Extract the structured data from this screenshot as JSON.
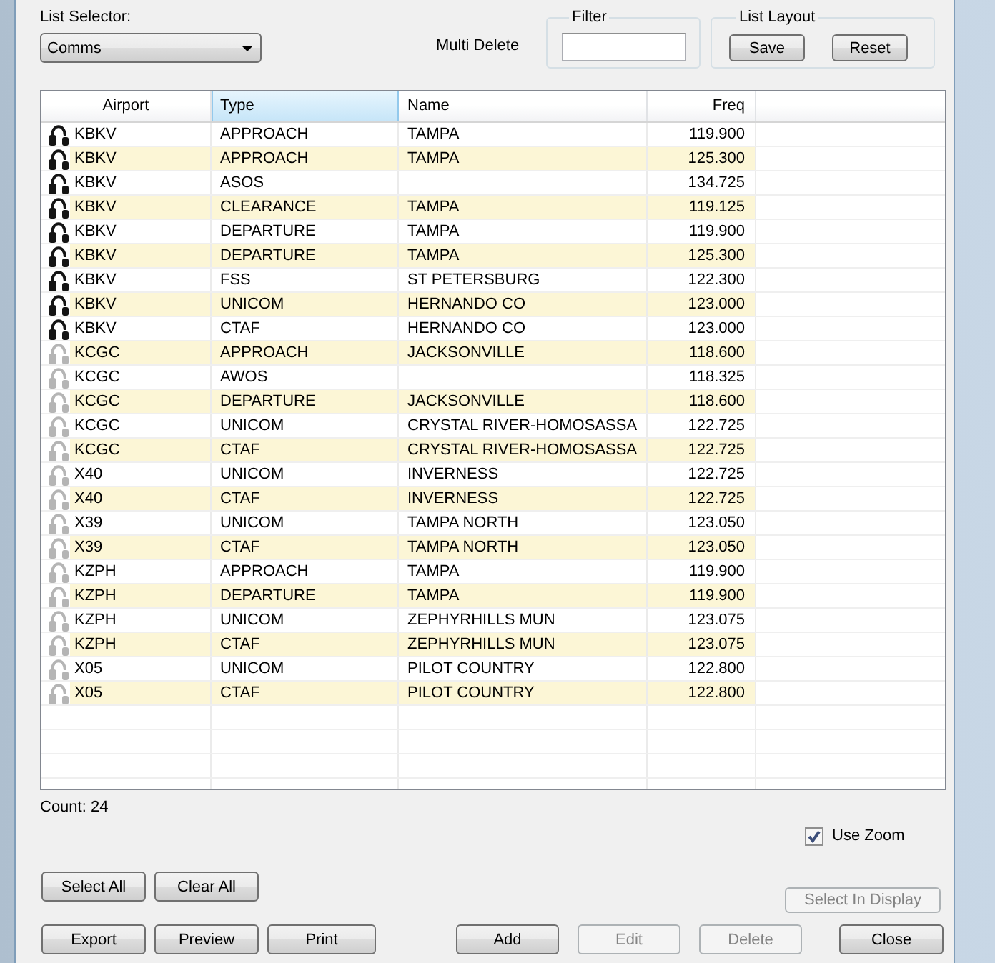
{
  "list_selector": {
    "label": "List Selector:",
    "value": "Comms"
  },
  "multi_delete": {
    "label": "Multi Delete"
  },
  "filter": {
    "title": "Filter"
  },
  "list_layout": {
    "title": "List Layout",
    "buttons": [
      {
        "label": "Save"
      },
      {
        "label": "Reset"
      }
    ]
  },
  "table": {
    "columns": [
      {
        "label": "Airport",
        "selected": false
      },
      {
        "label": "Type",
        "selected": true
      },
      {
        "label": "Name",
        "selected": false
      },
      {
        "label": "Freq",
        "selected": false
      }
    ],
    "rows": [
      {
        "airport": "KBKV",
        "type": "APPROACH",
        "name": "TAMPA",
        "freq": "119.900",
        "dimmed": false
      },
      {
        "airport": "KBKV",
        "type": "APPROACH",
        "name": "TAMPA",
        "freq": "125.300",
        "dimmed": false
      },
      {
        "airport": "KBKV",
        "type": "ASOS",
        "freq": "134.725",
        "dimmed": false
      },
      {
        "airport": "KBKV",
        "type": "CLEARANCE",
        "name": "TAMPA",
        "freq": "119.125",
        "dimmed": false
      },
      {
        "airport": "KBKV",
        "type": "DEPARTURE",
        "name": "TAMPA",
        "freq": "119.900",
        "dimmed": false
      },
      {
        "airport": "KBKV",
        "type": "DEPARTURE",
        "name": "TAMPA",
        "freq": "125.300",
        "dimmed": false
      },
      {
        "airport": "KBKV",
        "type": "FSS",
        "name": "ST PETERSBURG",
        "freq": "122.300",
        "dimmed": false
      },
      {
        "airport": "KBKV",
        "type": "UNICOM",
        "name": "HERNANDO CO",
        "freq": "123.000",
        "dimmed": false
      },
      {
        "airport": "KBKV",
        "type": "CTAF",
        "name": "HERNANDO CO",
        "freq": "123.000",
        "dimmed": false
      },
      {
        "airport": "KCGC",
        "type": "APPROACH",
        "name": "JACKSONVILLE",
        "freq": "118.600",
        "dimmed": true
      },
      {
        "airport": "KCGC",
        "type": "AWOS",
        "freq": "118.325",
        "dimmed": true
      },
      {
        "airport": "KCGC",
        "type": "DEPARTURE",
        "name": "JACKSONVILLE",
        "freq": "118.600",
        "dimmed": true
      },
      {
        "airport": "KCGC",
        "type": "UNICOM",
        "name": "CRYSTAL RIVER-HOMOSASSA",
        "freq": "122.725",
        "dimmed": true
      },
      {
        "airport": "KCGC",
        "type": "CTAF",
        "name": "CRYSTAL RIVER-HOMOSASSA",
        "freq": "122.725",
        "dimmed": true
      },
      {
        "airport": "X40",
        "type": "UNICOM",
        "name": "INVERNESS",
        "freq": "122.725",
        "dimmed": true
      },
      {
        "airport": "X40",
        "type": "CTAF",
        "name": "INVERNESS",
        "freq": "122.725",
        "dimmed": true
      },
      {
        "airport": "X39",
        "type": "UNICOM",
        "name": "TAMPA NORTH",
        "freq": "123.050",
        "dimmed": true
      },
      {
        "airport": "X39",
        "type": "CTAF",
        "name": "TAMPA NORTH",
        "freq": "123.050",
        "dimmed": true
      },
      {
        "airport": "KZPH",
        "type": "APPROACH",
        "name": "TAMPA",
        "freq": "119.900",
        "dimmed": true
      },
      {
        "airport": "KZPH",
        "type": "DEPARTURE",
        "name": "TAMPA",
        "freq": "119.900",
        "dimmed": true
      },
      {
        "airport": "KZPH",
        "type": "UNICOM",
        "name": "ZEPHYRHILLS MUN",
        "freq": "123.075",
        "dimmed": true
      },
      {
        "airport": "KZPH",
        "type": "CTAF",
        "name": "ZEPHYRHILLS MUN",
        "freq": "123.075",
        "dimmed": true
      },
      {
        "airport": "X05",
        "type": "UNICOM",
        "name": "PILOT COUNTRY",
        "freq": "122.800",
        "dimmed": true
      },
      {
        "airport": "X05",
        "type": "CTAF",
        "name": "PILOT COUNTRY",
        "freq": "122.800",
        "dimmed": true
      }
    ]
  },
  "count": "Count: 24",
  "use_zoom": {
    "label": "Use Zoom",
    "checked": true
  },
  "selection_buttons": [
    {
      "label": "Select All"
    },
    {
      "label": "Clear All"
    }
  ],
  "select_in_display": {
    "label": "Select In Display",
    "disabled": true
  },
  "output_buttons": [
    {
      "label": "Export"
    },
    {
      "label": "Preview"
    },
    {
      "label": "Print"
    }
  ],
  "edit_buttons": [
    {
      "label": "Add",
      "disabled": false
    },
    {
      "label": "Edit",
      "disabled": true
    },
    {
      "label": "Delete",
      "disabled": true
    }
  ],
  "close_button": {
    "label": "Close"
  }
}
